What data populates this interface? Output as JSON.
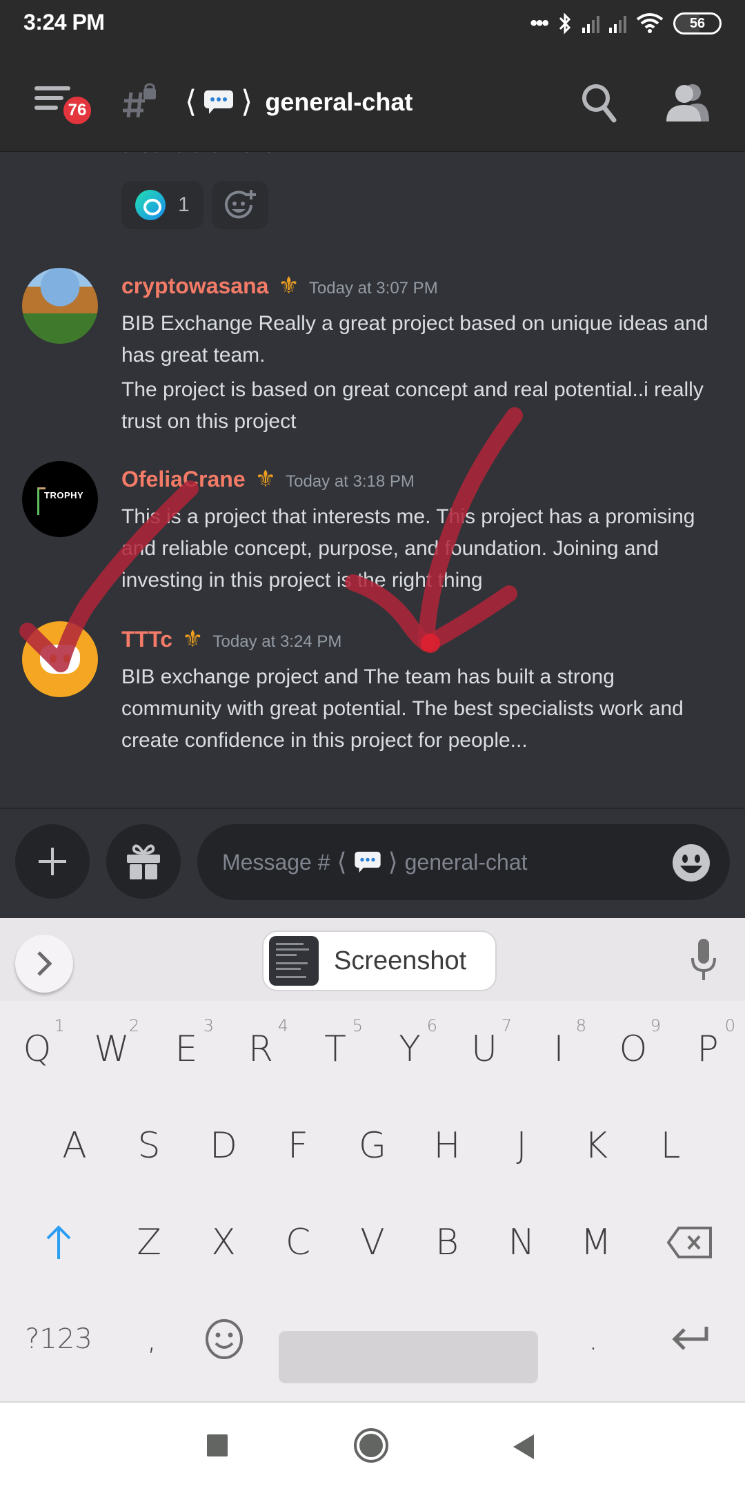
{
  "status_bar": {
    "time": "3:24 PM",
    "battery": "56"
  },
  "header": {
    "unread_badge": "76",
    "channel_name": "general-chat",
    "channel_bracket_left": "⟨",
    "channel_bracket_right": "⟩",
    "icons": [
      "hamburger-menu-icon",
      "locked-channel-icon",
      "speech-bubble-icon",
      "search-icon",
      "members-icon"
    ]
  },
  "chat": {
    "previous_message_tail": "around the world.",
    "reactions": [
      {
        "emoji": "custom-emoji-icon",
        "count": "1"
      },
      {
        "emoji": "add-reaction-icon"
      }
    ],
    "messages": [
      {
        "username": "cryptowasana",
        "badge": "⚜",
        "timestamp": "Today at 3:07 PM",
        "paragraphs": [
          "BIB Exchange Really a great project based on unique ideas and has great team.",
          "The project is based on great concept and real potential..i really trust on this project"
        ]
      },
      {
        "username": "OfeliaCrane",
        "badge": "⚜",
        "timestamp": "Today at 3:18 PM",
        "avatar_text": "TROPHY",
        "paragraphs": [
          "This is a project that interests me. This project has a promising and reliable concept, purpose, and foundation. Joining and investing in this project is the right thing"
        ]
      },
      {
        "username": "TTTc",
        "badge": "⚜",
        "timestamp": "Today at 3:24 PM",
        "paragraphs": [
          "BIB exchange project and The team has built a strong community with great potential. The best specialists work and create confidence in this project for people..."
        ]
      }
    ],
    "annotation_color": "#b0263a"
  },
  "composer": {
    "placeholder_prefix": "Message #",
    "placeholder_channel": "general-chat"
  },
  "keyboard": {
    "clipboard_label": "Screenshot",
    "row1": [
      {
        "k": "Q",
        "n": "1"
      },
      {
        "k": "W",
        "n": "2"
      },
      {
        "k": "E",
        "n": "3"
      },
      {
        "k": "R",
        "n": "4"
      },
      {
        "k": "T",
        "n": "5"
      },
      {
        "k": "Y",
        "n": "6"
      },
      {
        "k": "U",
        "n": "7"
      },
      {
        "k": "I",
        "n": "8"
      },
      {
        "k": "O",
        "n": "9"
      },
      {
        "k": "P",
        "n": "0"
      }
    ],
    "row2": [
      "A",
      "S",
      "D",
      "F",
      "G",
      "H",
      "J",
      "K",
      "L"
    ],
    "row3": [
      "Z",
      "X",
      "C",
      "V",
      "B",
      "N",
      "M"
    ],
    "symbols_key": "?123",
    "comma_key": ",",
    "period_key": ".",
    "shift_color": "#2a9df4"
  },
  "colors": {
    "username": "#f47b67",
    "badge": "#f0a020",
    "timestamp": "#949ba4",
    "notification": "#e3353d"
  }
}
